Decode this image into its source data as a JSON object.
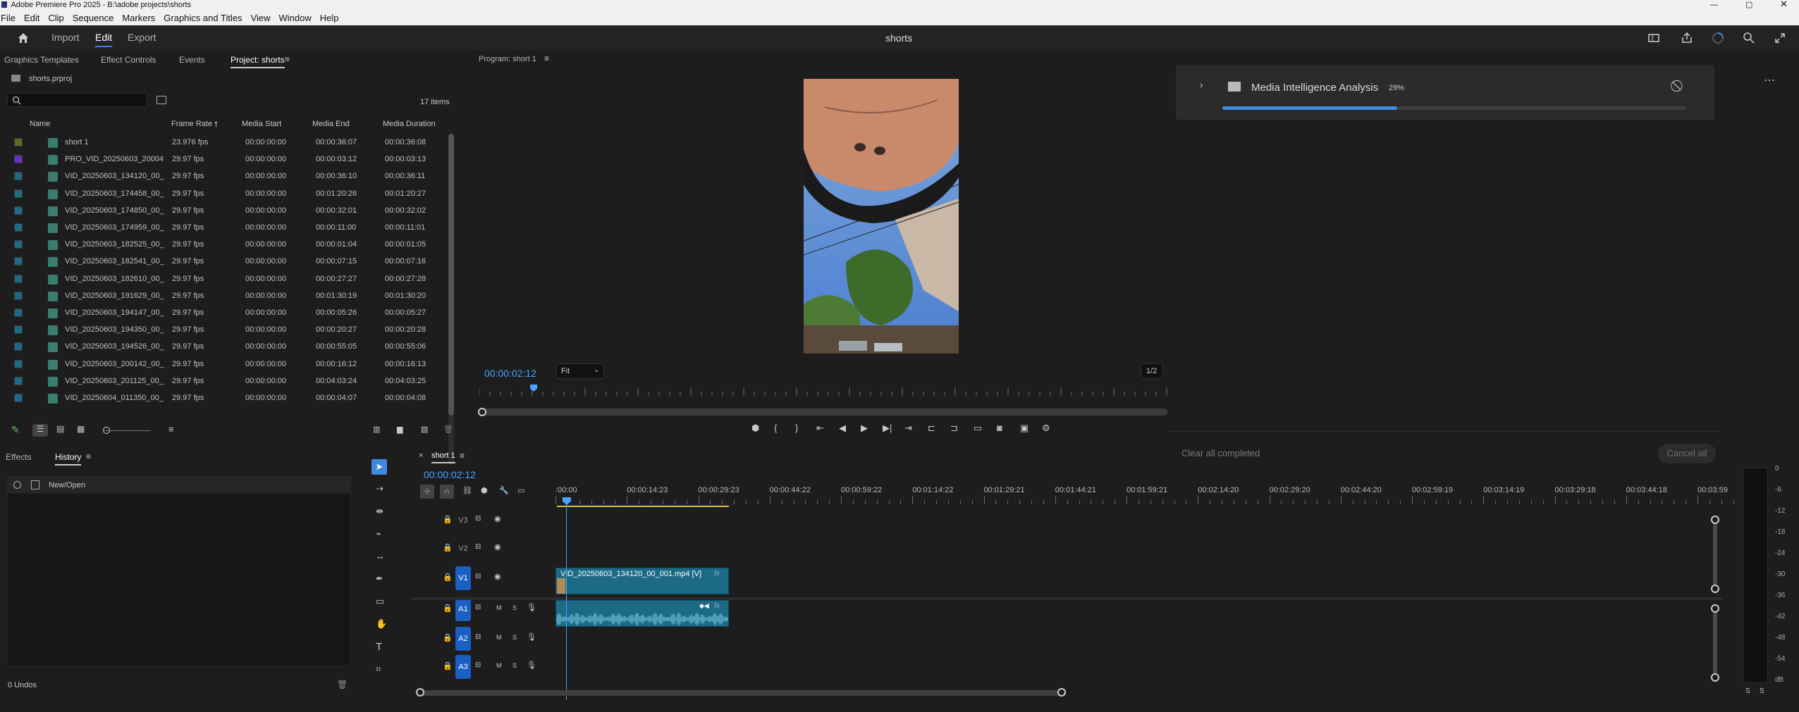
{
  "window": {
    "title": "Adobe Premiere Pro 2025 - B:\\adobe projects\\shorts"
  },
  "menu": [
    "File",
    "Edit",
    "Clip",
    "Sequence",
    "Markers",
    "Graphics and Titles",
    "View",
    "Window",
    "Help"
  ],
  "header": {
    "nav": [
      "Import",
      "Edit",
      "Export"
    ],
    "active": "Edit",
    "project_name": "shorts"
  },
  "project_panel": {
    "tabs": [
      "Graphics Templates",
      "Effect Controls",
      "Events",
      "Project: shorts"
    ],
    "file": "shorts.prproj",
    "item_count": "17 items",
    "columns": [
      "Name",
      "Frame Rate",
      "Media Start",
      "Media End",
      "Media Duration"
    ],
    "rows": [
      {
        "name": "short 1",
        "rate": "23.976 fps",
        "start": "00:00:00:00",
        "end": "00:00:36:07",
        "dur": "00:00:36:08",
        "color": "#5b6b1f"
      },
      {
        "name": "PRO_VID_20250603_20004",
        "rate": "29.97 fps",
        "start": "00:00:00:00",
        "end": "00:00:03:12",
        "dur": "00:00:03:13",
        "color": "#6a2fc8"
      },
      {
        "name": "VID_20250603_134120_00_",
        "rate": "29.97 fps",
        "start": "00:00:00:00",
        "end": "00:00:36:10",
        "dur": "00:00:36:11",
        "color": "#1e6a86"
      },
      {
        "name": "VID_20250603_174458_00_",
        "rate": "29.97 fps",
        "start": "00:00:00:00",
        "end": "00:01:20:26",
        "dur": "00:01:20:27",
        "color": "#1e6a86"
      },
      {
        "name": "VID_20250603_174850_00_",
        "rate": "29.97 fps",
        "start": "00:00:00:00",
        "end": "00:00:32:01",
        "dur": "00:00:32:02",
        "color": "#1e6a86"
      },
      {
        "name": "VID_20250603_174959_00_",
        "rate": "29.97 fps",
        "start": "00:00:00:00",
        "end": "00:00:11:00",
        "dur": "00:00:11:01",
        "color": "#1e6a86"
      },
      {
        "name": "VID_20250603_182525_00_",
        "rate": "29.97 fps",
        "start": "00:00:00:00",
        "end": "00:00:01:04",
        "dur": "00:00:01:05",
        "color": "#1e6a86"
      },
      {
        "name": "VID_20250603_182541_00_",
        "rate": "29.97 fps",
        "start": "00:00:00:00",
        "end": "00:00:07:15",
        "dur": "00:00:07:16",
        "color": "#1e6a86"
      },
      {
        "name": "VID_20250603_182610_00_",
        "rate": "29.97 fps",
        "start": "00:00:00:00",
        "end": "00:00:27:27",
        "dur": "00:00:27:28",
        "color": "#1e6a86"
      },
      {
        "name": "VID_20250603_191629_00_",
        "rate": "29.97 fps",
        "start": "00:00:00:00",
        "end": "00:01:30:19",
        "dur": "00:01:30:20",
        "color": "#1e6a86"
      },
      {
        "name": "VID_20250603_194147_00_",
        "rate": "29.97 fps",
        "start": "00:00:00:00",
        "end": "00:00:05:26",
        "dur": "00:00:05:27",
        "color": "#1e6a86"
      },
      {
        "name": "VID_20250603_194350_00_",
        "rate": "29.97 fps",
        "start": "00:00:00:00",
        "end": "00:00:20:27",
        "dur": "00:00:20:28",
        "color": "#1e6a86"
      },
      {
        "name": "VID_20250603_194526_00_",
        "rate": "29.97 fps",
        "start": "00:00:00:00",
        "end": "00:00:55:05",
        "dur": "00:00:55:06",
        "color": "#1e6a86"
      },
      {
        "name": "VID_20250603_200142_00_",
        "rate": "29.97 fps",
        "start": "00:00:00:00",
        "end": "00:00:16:12",
        "dur": "00:00:16:13",
        "color": "#1e6a86"
      },
      {
        "name": "VID_20250603_201125_00_",
        "rate": "29.97 fps",
        "start": "00:00:00:00",
        "end": "00:04:03:24",
        "dur": "00:04:03:25",
        "color": "#1e6a86"
      },
      {
        "name": "VID_20250604_011350_00_",
        "rate": "29.97 fps",
        "start": "00:00:00:00",
        "end": "00:00:04:07",
        "dur": "00:00:04:08",
        "color": "#1e6a86"
      }
    ]
  },
  "program_monitor": {
    "title": "Program: short 1",
    "timecode": "00:00:02:12",
    "fit": "Fit",
    "resolution": "1/2"
  },
  "progress_panel": {
    "task": "Media Intelligence Analysis",
    "percent_label": "29%",
    "progress": 0.29,
    "clear_label": "Clear all completed",
    "cancel_label": "Cancel all"
  },
  "history_panel": {
    "tabs": [
      "Effects",
      "History"
    ],
    "entries": [
      "New/Open"
    ],
    "undos": "0 Undos"
  },
  "timeline": {
    "sequence": "short 1",
    "timecode": "00:00:02:12",
    "ruler": [
      ":00:00",
      "00:00:14:23",
      "00:00:29:23",
      "00:00:44:22",
      "00:00:59:22",
      "00:01:14:22",
      "00:01:29:21",
      "00:01:44:21",
      "00:01:59:21",
      "00:02:14:20",
      "00:02:29:20",
      "00:02:44:20",
      "00:02:59:19",
      "00:03:14:19",
      "00:03:29:18",
      "00:03:44:18",
      "00:03:59"
    ],
    "tracks": [
      "V3",
      "V2",
      "V1",
      "A1",
      "A2",
      "A3"
    ],
    "video_clip": "VID_20250603_134120_00_001.mp4 [V]",
    "fx": "fx"
  },
  "meter": {
    "scale": [
      "0",
      "-6",
      "-12",
      "-18",
      "-24",
      "-30",
      "-36",
      "-42",
      "-48",
      "-54",
      "dB"
    ],
    "solo": [
      "S",
      "S"
    ]
  }
}
